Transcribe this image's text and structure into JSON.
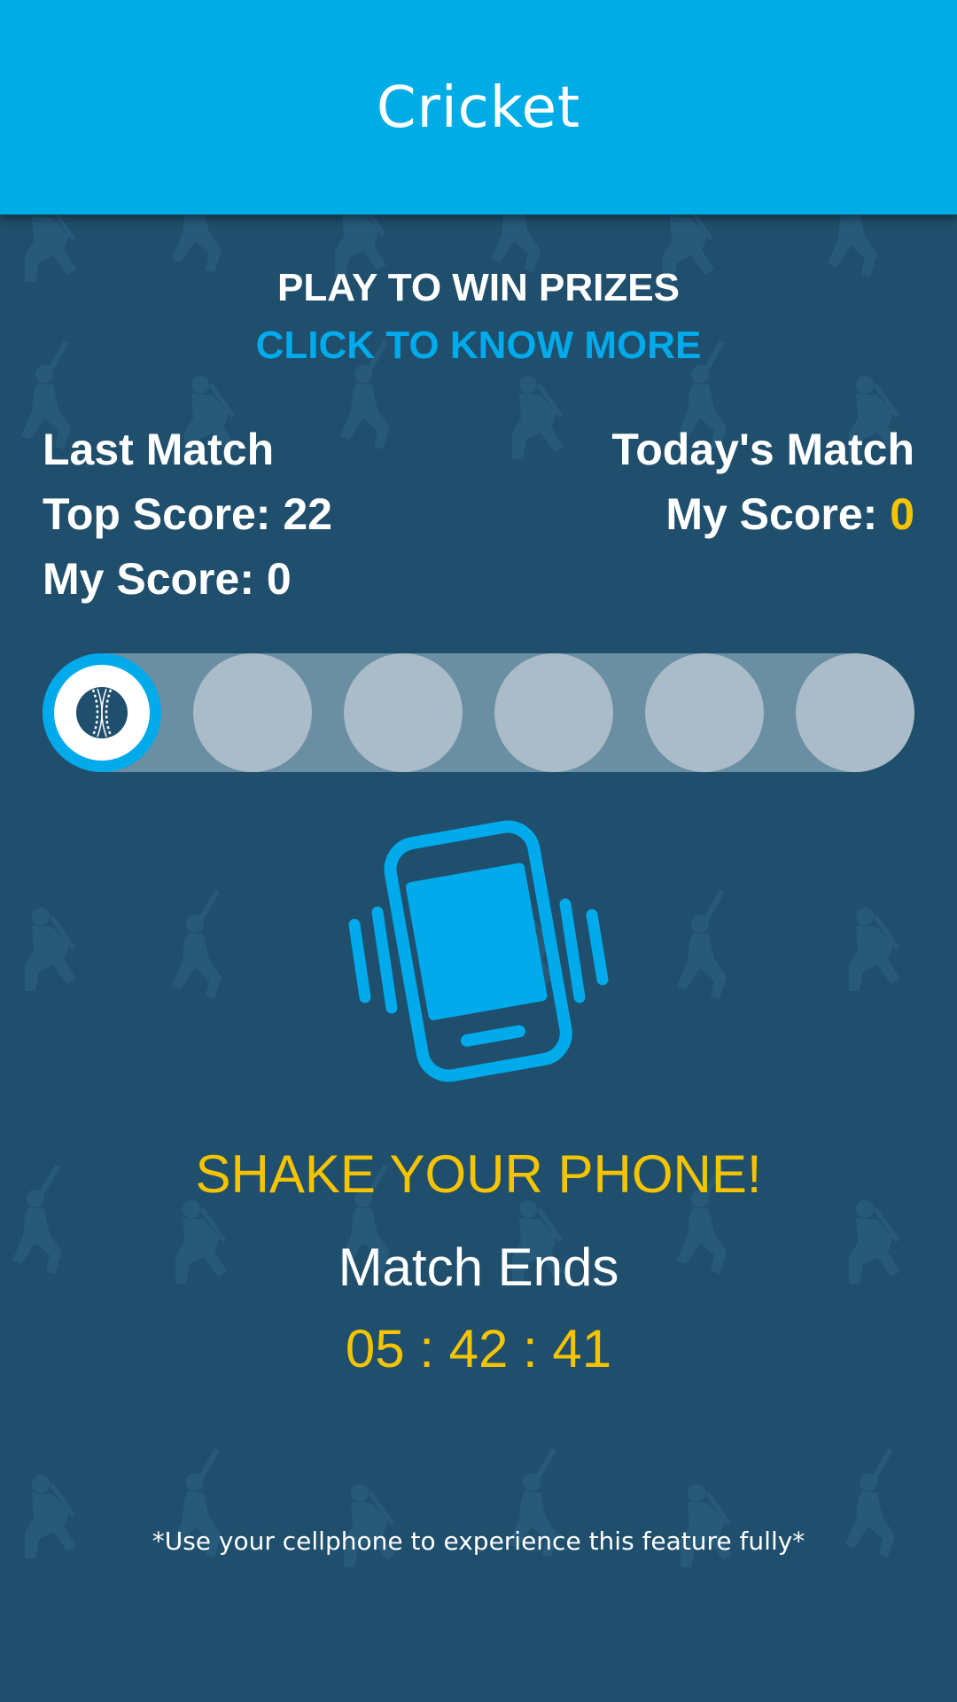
{
  "header": {
    "title": "Cricket",
    "color": "#00ace6"
  },
  "promo": {
    "title": "PLAY TO WIN PRIZES",
    "link": "CLICK TO KNOW MORE"
  },
  "last_match": {
    "heading": "Last Match",
    "top_score_label": "Top Score:",
    "top_score_value": "22",
    "my_score_label": "My Score:",
    "my_score_value": "0"
  },
  "todays_match": {
    "heading": "Today's Match",
    "my_score_label": "My Score:",
    "my_score_value": "0"
  },
  "ball_tracker": {
    "total_slots": 6,
    "active_index": 0,
    "active_icon": "cricket-ball-icon"
  },
  "shake": {
    "icon": "shake-phone-icon",
    "prompt": "SHAKE YOUR PHONE!"
  },
  "match_timer": {
    "label": "Match Ends",
    "countdown": "05 : 42 : 41"
  },
  "footer": {
    "note": "*Use your cellphone to experience this feature fully*"
  },
  "colors": {
    "background": "#1f4f6c",
    "accent_blue": "#00aaeb",
    "accent_yellow": "#f5c400"
  }
}
